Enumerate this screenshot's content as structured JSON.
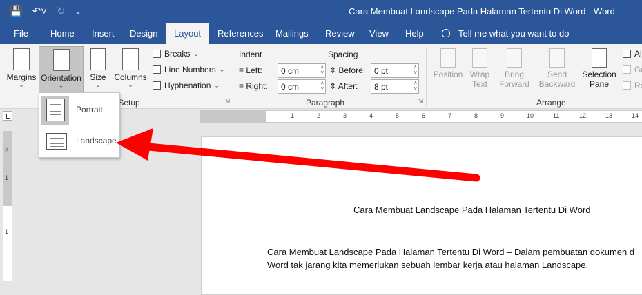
{
  "window": {
    "title": "Cara Membuat Landscape Pada Halaman Tertentu Di Word  -  Word"
  },
  "qat": {
    "save_icon": "save-icon",
    "undo_icon": "undo-icon",
    "redo_icon": "redo-icon",
    "customize_icon": "customize-qat-icon"
  },
  "tabs": [
    "File",
    "Home",
    "Insert",
    "Design",
    "Layout",
    "References",
    "Mailings",
    "Review",
    "View",
    "Help"
  ],
  "active_tab": "Layout",
  "tell_me": "Tell me what you want to do",
  "ribbon": {
    "page_setup": {
      "margins": "Margins",
      "orientation": "Orientation",
      "size": "Size",
      "columns": "Columns",
      "breaks": "Breaks",
      "line_numbers": "Line Numbers",
      "hyphenation": "Hyphenation",
      "group_label": "Page Setup"
    },
    "paragraph": {
      "indent_label": "Indent",
      "spacing_label": "Spacing",
      "left_label": "Left:",
      "right_label": "Right:",
      "before_label": "Before:",
      "after_label": "After:",
      "left_value": "0 cm",
      "right_value": "0 cm",
      "before_value": "0 pt",
      "after_value": "8 pt",
      "group_label": "Paragraph"
    },
    "arrange": {
      "position": "Position",
      "wrap_text_1": "Wrap",
      "wrap_text_2": "Text",
      "bring_forward_1": "Bring",
      "bring_forward_2": "Forward",
      "send_backward_1": "Send",
      "send_backward_2": "Backward",
      "selection_pane_1": "Selection",
      "selection_pane_2": "Pane",
      "align": "Ali",
      "group": "Gr",
      "rotate": "Ro",
      "group_label": "Arrange"
    }
  },
  "orientation_menu": {
    "portrait": "Portrait",
    "landscape": "Landscape"
  },
  "ruler": {
    "marks": [
      "1",
      "2",
      "3",
      "4",
      "5",
      "6",
      "7",
      "8",
      "9",
      "10",
      "11",
      "12",
      "13",
      "14"
    ],
    "vertical_marks": [
      "2",
      "1",
      "1"
    ]
  },
  "document": {
    "title": "Cara Membuat Landscape Pada Halaman Tertentu Di Word",
    "para_line1": "Cara Membuat Landscape Pada Halaman Tertentu Di Word – Dalam pembuatan dokumen d",
    "para_line2": "Word tak jarang kita memerlukan sebuah lembar kerja atau halaman Landscape."
  },
  "colors": {
    "titlebar": "#2b579a",
    "arrow": "#ff0000"
  }
}
